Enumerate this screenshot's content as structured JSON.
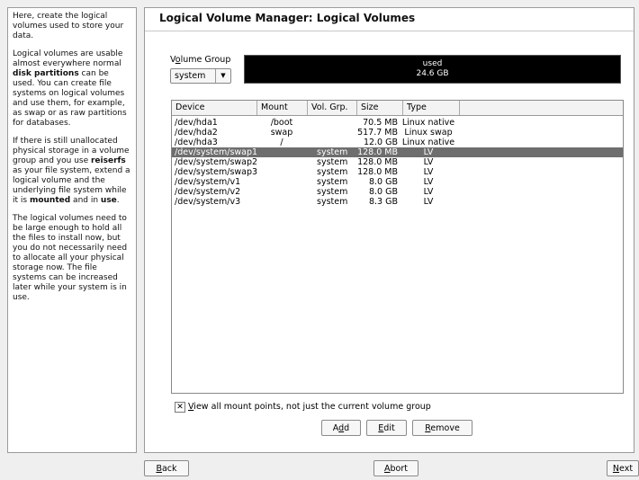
{
  "help": {
    "paragraphs": [
      [
        {
          "t": "Here, create the logical volumes used to store your data."
        }
      ],
      [
        {
          "t": "Logical volumes are usable almost everywhere normal "
        },
        {
          "t": "disk partitions",
          "b": true
        },
        {
          "t": " can be used. You can create file systems on logical volumes and use them, for example, as swap or as raw partitions for databases."
        }
      ],
      [
        {
          "t": "If there is still unallocated physical storage in a volume group and you use "
        },
        {
          "t": "reiserfs",
          "b": true
        },
        {
          "t": " as your file system, extend a logical volume and the underlying file system while it is "
        },
        {
          "t": "mounted",
          "b": true
        },
        {
          "t": " and in "
        },
        {
          "t": "use",
          "b": true
        },
        {
          "t": "."
        }
      ],
      [
        {
          "t": "The logical volumes need to be large enough to hold all the files to install now, but you do not necessarily need to allocate all your physical storage now. The file systems can be increased later while your system is in use."
        }
      ]
    ]
  },
  "main": {
    "title": "Logical Volume Manager: Logical Volumes",
    "volume_group_label": "Volume Group",
    "volume_group_value": "system",
    "usage_label": "used",
    "usage_value": "24.6 GB"
  },
  "table": {
    "headers": [
      "Device",
      "Mount",
      "Vol. Grp.",
      "Size",
      "Type"
    ],
    "rows": [
      {
        "device": "/dev/hda1",
        "mount": "/boot",
        "vg": "",
        "size": "70.5 MB",
        "type": "Linux native",
        "selected": false
      },
      {
        "device": "/dev/hda2",
        "mount": "swap",
        "vg": "",
        "size": "517.7 MB",
        "type": "Linux swap",
        "selected": false
      },
      {
        "device": "/dev/hda3",
        "mount": "/",
        "vg": "",
        "size": "12.0 GB",
        "type": "Linux native",
        "selected": false
      },
      {
        "device": "/dev/system/swap1",
        "mount": "",
        "vg": "system",
        "size": "128.0 MB",
        "type": "LV",
        "selected": true
      },
      {
        "device": "/dev/system/swap2",
        "mount": "",
        "vg": "system",
        "size": "128.0 MB",
        "type": "LV",
        "selected": false
      },
      {
        "device": "/dev/system/swap3",
        "mount": "",
        "vg": "system",
        "size": "128.0 MB",
        "type": "LV",
        "selected": false
      },
      {
        "device": "/dev/system/v1",
        "mount": "",
        "vg": "system",
        "size": "8.0 GB",
        "type": "LV",
        "selected": false
      },
      {
        "device": "/dev/system/v2",
        "mount": "",
        "vg": "system",
        "size": "8.0 GB",
        "type": "LV",
        "selected": false
      },
      {
        "device": "/dev/system/v3",
        "mount": "",
        "vg": "system",
        "size": "8.3 GB",
        "type": "LV",
        "selected": false
      }
    ]
  },
  "options": {
    "view_all_label": "View all mount points, not just the current volume group",
    "view_all_checked": true
  },
  "buttons": {
    "add": "Add",
    "edit": "Edit",
    "remove": "Remove"
  },
  "nav": {
    "back": "Back",
    "abort": "Abort",
    "next": "Next"
  }
}
